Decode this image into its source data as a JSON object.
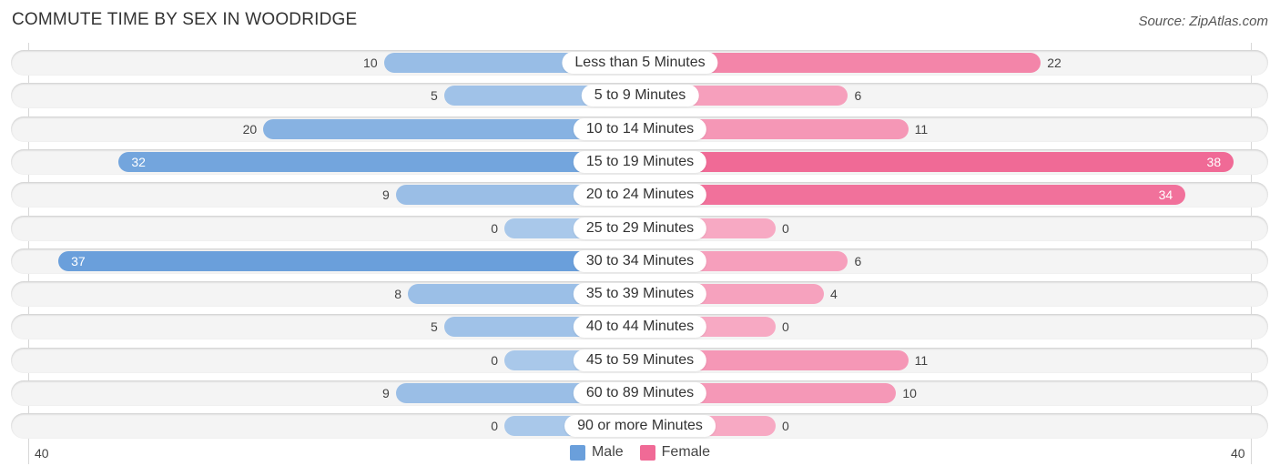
{
  "chart_data": {
    "type": "bar",
    "orientation": "horizontal-diverging",
    "title": "COMMUTE TIME BY SEX IN WOODRIDGE",
    "source": "Source: ZipAtlas.com",
    "categories": [
      "Less than 5 Minutes",
      "5 to 9 Minutes",
      "10 to 14 Minutes",
      "15 to 19 Minutes",
      "20 to 24 Minutes",
      "25 to 29 Minutes",
      "30 to 34 Minutes",
      "35 to 39 Minutes",
      "40 to 44 Minutes",
      "45 to 59 Minutes",
      "60 to 89 Minutes",
      "90 or more Minutes"
    ],
    "series": [
      {
        "name": "Male",
        "color": "#6a9fdb",
        "values": [
          10,
          5,
          20,
          32,
          9,
          0,
          37,
          8,
          5,
          0,
          9,
          0
        ]
      },
      {
        "name": "Female",
        "color": "#f06a96",
        "values": [
          22,
          6,
          11,
          38,
          34,
          0,
          6,
          4,
          0,
          11,
          10,
          0
        ]
      }
    ],
    "axis_ticks": {
      "left": "40",
      "right": "40"
    },
    "xlim": [
      -40,
      40
    ],
    "legend_position": "bottom-center"
  }
}
